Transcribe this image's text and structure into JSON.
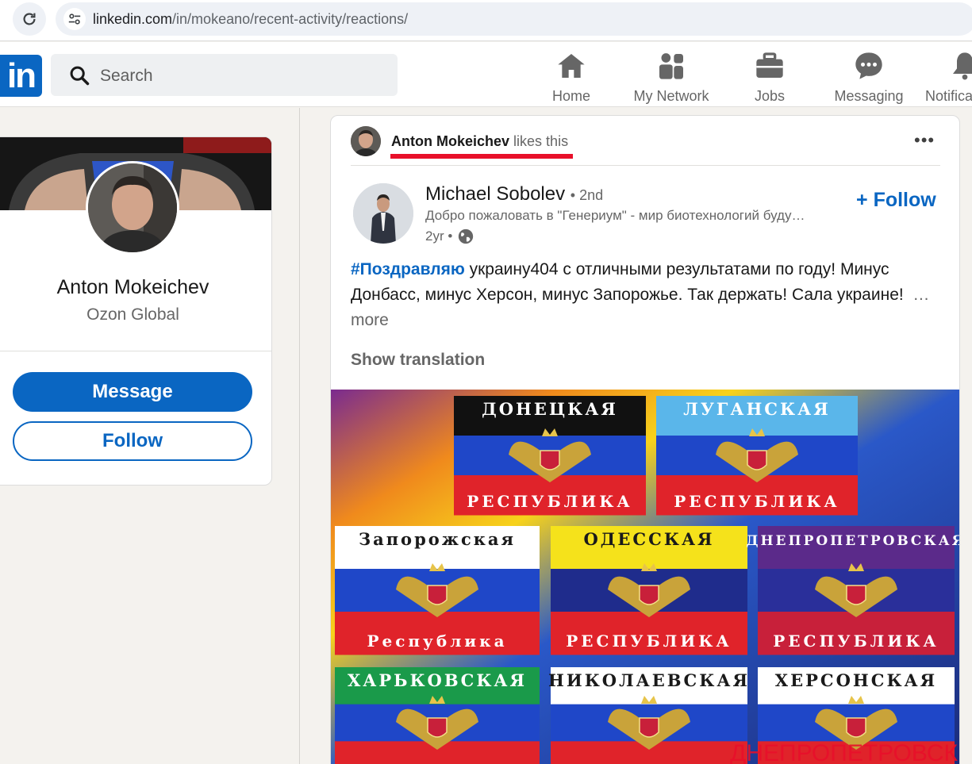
{
  "browser": {
    "url_host": "linkedin.com",
    "url_path": "/in/mokeano/recent-activity/reactions/"
  },
  "header": {
    "logo": "in",
    "search_placeholder": "Search",
    "nav": [
      {
        "label": "Home",
        "icon": "home-icon"
      },
      {
        "label": "My Network",
        "icon": "network-icon"
      },
      {
        "label": "Jobs",
        "icon": "briefcase-icon"
      },
      {
        "label": "Messaging",
        "icon": "messaging-icon"
      },
      {
        "label": "Notifica",
        "icon": "bell-icon"
      }
    ]
  },
  "profile": {
    "name": "Anton Mokeichev",
    "company": "Ozon Global",
    "message_label": "Message",
    "follow_label": "Follow"
  },
  "post": {
    "actor": "Anton Mokeichev",
    "action": "likes this",
    "author_name": "Michael Sobolev",
    "author_degree": "• 2nd",
    "author_headline": "Добро пожаловать в \"Генериум\" - мир биотехнологий буду…",
    "time": "2yr •",
    "follow_label": "Follow",
    "hashtag": "#Поздравляю",
    "body": "украину404 с отличными результатами по году! Минус Донбасс, минус Херсон, минус Запорожье. Так держать! Сала украине!",
    "see_more": "…more",
    "show_translation": "Show translation",
    "image": {
      "flags": [
        {
          "title": "ДОНЕЦКАЯ",
          "subtitle": "РЕСПУБЛИКА",
          "stripes": [
            "#111111",
            "#1f47c8",
            "#e0232a"
          ]
        },
        {
          "title": "ЛУГАНСКАЯ",
          "subtitle": "РЕСПУБЛИКА",
          "stripes": [
            "#5ab6ea",
            "#1f47c8",
            "#e0232a"
          ]
        },
        {
          "title": "Запорожская",
          "subtitle": "Республика",
          "stripes": [
            "#ffffff",
            "#1f47c8",
            "#e0232a"
          ]
        },
        {
          "title": "ОДЕССКАЯ",
          "subtitle": "РЕСПУБЛИКА",
          "stripes": [
            "#f5e21b",
            "#1f2c8c",
            "#e0232a"
          ]
        },
        {
          "title": "ДНЕПРОПЕТРОВСКАЯ",
          "subtitle": "РЕСПУБЛИКА",
          "stripes": [
            "#5b2a8a",
            "#2a2f9a",
            "#c8203a"
          ]
        },
        {
          "title": "ХАРЬКОВСКАЯ",
          "subtitle": "",
          "stripes": [
            "#1a9a4a",
            "#1f47c8",
            "#e0232a"
          ]
        },
        {
          "title": "НИКОЛАЕВСКАЯ",
          "subtitle": "",
          "stripes": [
            "#ffffff",
            "#1f47c8",
            "#e0232a"
          ]
        },
        {
          "title": "ХЕРСОНСКАЯ",
          "subtitle": "",
          "stripes": [
            "#ffffff",
            "#1f47c8",
            "#e0232a"
          ]
        }
      ],
      "watermark": "ДНЕПРОПЕТРОВСК"
    }
  },
  "colors": {
    "brand": "#0a66c2",
    "highlight_red": "#e8102a"
  }
}
